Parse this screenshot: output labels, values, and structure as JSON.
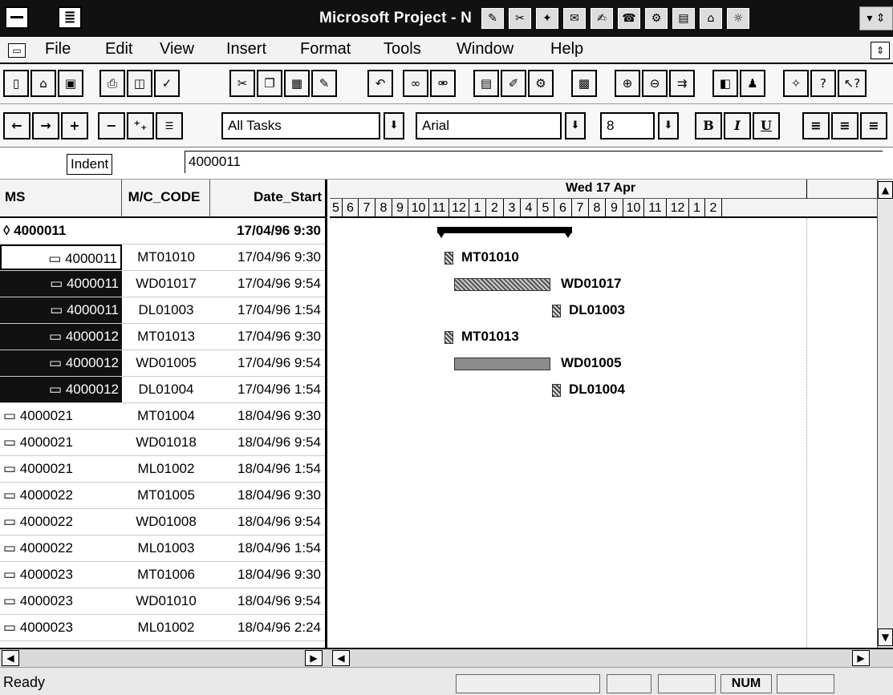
{
  "window": {
    "title": "Microsoft Project - N",
    "title_icons": [
      "app-icon-1",
      "app-icon-2",
      "app-icon-3",
      "app-icon-4",
      "app-icon-5",
      "app-icon-6",
      "app-icon-7",
      "app-icon-8",
      "app-icon-9",
      "app-icon-10"
    ],
    "doc_icon": "≣"
  },
  "menu": {
    "items": [
      "File",
      "Edit",
      "View",
      "Insert",
      "Format",
      "Tools",
      "Window",
      "Help"
    ]
  },
  "toolbar": {
    "standard_icons": [
      "new",
      "open",
      "save",
      "print",
      "print-preview",
      "spelling",
      "cut",
      "copy",
      "paste",
      "format-painter",
      "undo",
      "link",
      "unlink",
      "task-info",
      "notes",
      "gantt-wizard",
      "copy-picture",
      "zoom-in",
      "zoom-out",
      "goto-selected",
      "assign",
      "resource",
      "tip-wizard",
      "help",
      "context-help"
    ],
    "formatting": {
      "filter_value": "All Tasks",
      "font_value": "Arial",
      "size_value": "8",
      "bold": "B",
      "italic": "I",
      "underline": "U"
    }
  },
  "entry_bar": {
    "tooltip": "Indent",
    "value": "4000011"
  },
  "table": {
    "headers": {
      "ms": "MS",
      "mc": "M/C_CODE",
      "ds": "Date_Start"
    },
    "rows": [
      {
        "ms": "◊ 4000011",
        "mc": "",
        "ds": "17/04/96 9:30",
        "kind": "summary"
      },
      {
        "ms": "▭ 4000011",
        "mc": "MT01010",
        "ds": "17/04/96 9:30",
        "kind": "current"
      },
      {
        "ms": "▭ 4000011",
        "mc": "WD01017",
        "ds": "17/04/96 9:54",
        "kind": "selected"
      },
      {
        "ms": "▭ 4000011",
        "mc": "DL01003",
        "ds": "17/04/96 1:54",
        "kind": "selected"
      },
      {
        "ms": "▭ 4000012",
        "mc": "MT01013",
        "ds": "17/04/96 9:30",
        "kind": "selected"
      },
      {
        "ms": "▭ 4000012",
        "mc": "WD01005",
        "ds": "17/04/96 9:54",
        "kind": "selected"
      },
      {
        "ms": "▭ 4000012",
        "mc": "DL01004",
        "ds": "17/04/96 1:54",
        "kind": "selected"
      },
      {
        "ms": "▭ 4000021",
        "mc": "MT01004",
        "ds": "18/04/96 9:30",
        "kind": "normal"
      },
      {
        "ms": "▭ 4000021",
        "mc": "WD01018",
        "ds": "18/04/96 9:54",
        "kind": "normal"
      },
      {
        "ms": "▭ 4000021",
        "mc": "ML01002",
        "ds": "18/04/96 1:54",
        "kind": "normal"
      },
      {
        "ms": "▭ 4000022",
        "mc": "MT01005",
        "ds": "18/04/96 9:30",
        "kind": "normal"
      },
      {
        "ms": "▭ 4000022",
        "mc": "WD01008",
        "ds": "18/04/96 9:54",
        "kind": "normal"
      },
      {
        "ms": "▭ 4000022",
        "mc": "ML01003",
        "ds": "18/04/96 1:54",
        "kind": "normal"
      },
      {
        "ms": "▭ 4000023",
        "mc": "MT01006",
        "ds": "18/04/96 9:30",
        "kind": "normal"
      },
      {
        "ms": "▭ 4000023",
        "mc": "WD01010",
        "ds": "18/04/96 9:54",
        "kind": "normal"
      },
      {
        "ms": "▭ 4000023",
        "mc": "ML01002",
        "ds": "18/04/96 2:24",
        "kind": "normal"
      }
    ]
  },
  "gantt": {
    "day_label": "Wed 17 Apr",
    "hours": [
      "5",
      "6",
      "7",
      "8",
      "9",
      "10",
      "11",
      "12",
      "1",
      "2",
      "3",
      "4",
      "5",
      "6",
      "7",
      "8",
      "9",
      "10",
      "11",
      "12",
      "1",
      "2"
    ],
    "bars": [
      {
        "label": "MT01010",
        "type": "milestone"
      },
      {
        "label": "WD01017",
        "type": "hatch"
      },
      {
        "label": "DL01003",
        "type": "milestone"
      },
      {
        "label": "MT01013",
        "type": "milestone"
      },
      {
        "label": "WD01005",
        "type": "solid"
      },
      {
        "label": "DL01004",
        "type": "milestone"
      }
    ]
  },
  "status": {
    "text": "Ready",
    "num": "NUM"
  }
}
